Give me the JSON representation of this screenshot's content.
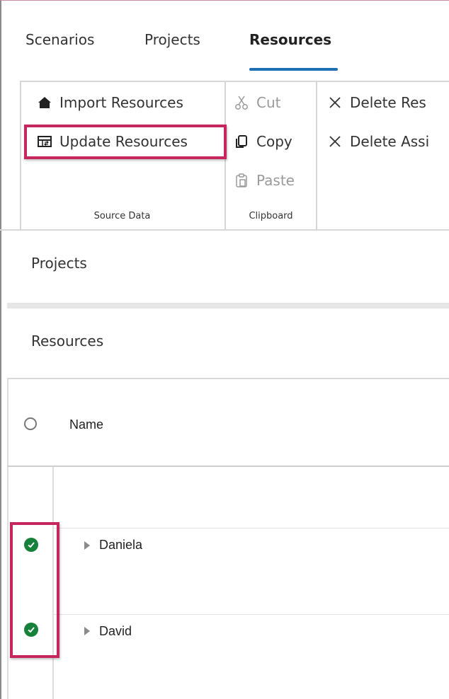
{
  "tabs": [
    {
      "label": "Scenarios"
    },
    {
      "label": "Projects"
    },
    {
      "label": "Resources",
      "active": true
    }
  ],
  "ribbon": {
    "source_data": {
      "group_label": "Source Data",
      "import_label": "Import Resources",
      "update_label": "Update Resources"
    },
    "clipboard": {
      "group_label": "Clipboard",
      "cut_label": "Cut",
      "copy_label": "Copy",
      "paste_label": "Paste"
    },
    "delete": {
      "delete_resources_label": "Delete Res",
      "delete_assignments_label": "Delete Assi"
    }
  },
  "sections": {
    "projects_title": "Projects",
    "resources_title": "Resources"
  },
  "table": {
    "header_name": "Name",
    "rows": [
      {
        "name": "Daniela",
        "status": "check"
      },
      {
        "name": "David",
        "status": "check"
      }
    ]
  },
  "colors": {
    "accent": "#1f6fb5",
    "highlight": "#c5265d",
    "status_ok": "#16813a"
  }
}
